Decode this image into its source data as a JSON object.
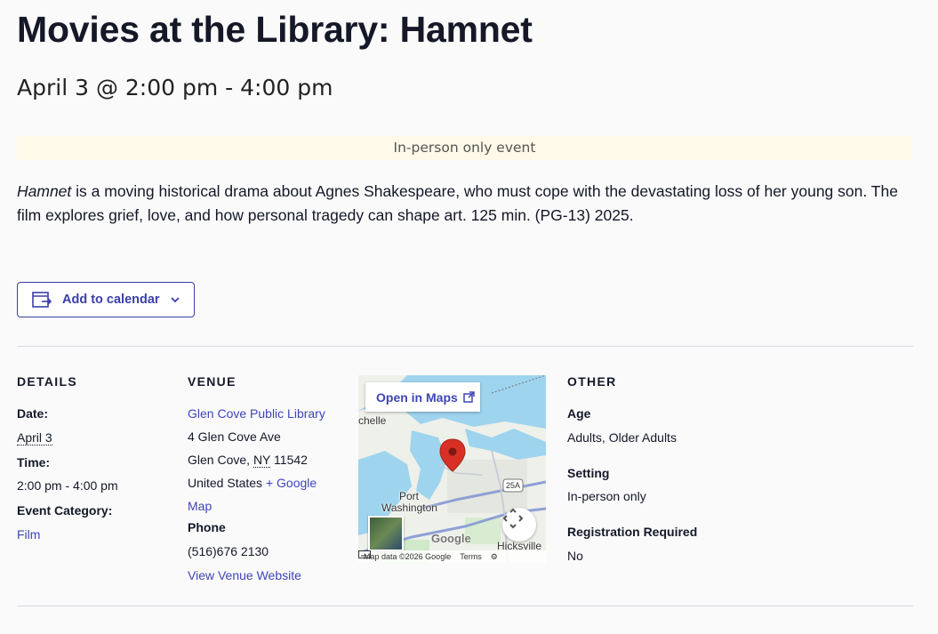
{
  "event": {
    "title": "Movies at the Library: Hamnet",
    "datetime": "April 3 @ 2:00 pm - 4:00 pm",
    "notice": "In-person only event",
    "description_italic": "Hamnet",
    "description_rest": " is a moving historical drama about Agnes Shakespeare, who must cope with the devastating loss of her young son. The film explores grief, love, and how personal tragedy can shape art. 125 min. (PG-13) 2025."
  },
  "calendar": {
    "label": "Add to calendar",
    "icon": "calendar-export-icon"
  },
  "details": {
    "heading": "DETAILS",
    "date_label": "Date:",
    "date_value": "April 3",
    "time_label": "Time:",
    "time_value": "2:00 pm - 4:00 pm",
    "category_label": "Event Category:",
    "category_value": "Film"
  },
  "venue": {
    "heading": "VENUE",
    "name": "Glen Cove Public Library",
    "street": "4 Glen Cove Ave",
    "city": "Glen Cove, ",
    "state": "NY",
    "zip": " 11542",
    "country": "United States",
    "google_map_1": "+ Google",
    "google_map_2": "Map",
    "phone_label": "Phone",
    "phone_value": "(516)676 2130",
    "website": "View Venue Website"
  },
  "map": {
    "open_label": "Open in Maps",
    "place_1": "chelle",
    "place_2a": "Port",
    "place_2b": "Washington",
    "place_3": "Hicksville",
    "route": "25A",
    "google": "Google",
    "footer_data": "Map data ©2026 Google",
    "footer_terms": "Terms"
  },
  "other": {
    "heading": "OTHER",
    "age_label": "Age",
    "age_value": "Adults, Older Adults",
    "setting_label": "Setting",
    "setting_value": "In-person only",
    "reg_label": "Registration Required",
    "reg_value": "No"
  },
  "colors": {
    "accent": "#3b3faa",
    "notice_bg": "#fef9e8",
    "pin": "#d93025"
  }
}
